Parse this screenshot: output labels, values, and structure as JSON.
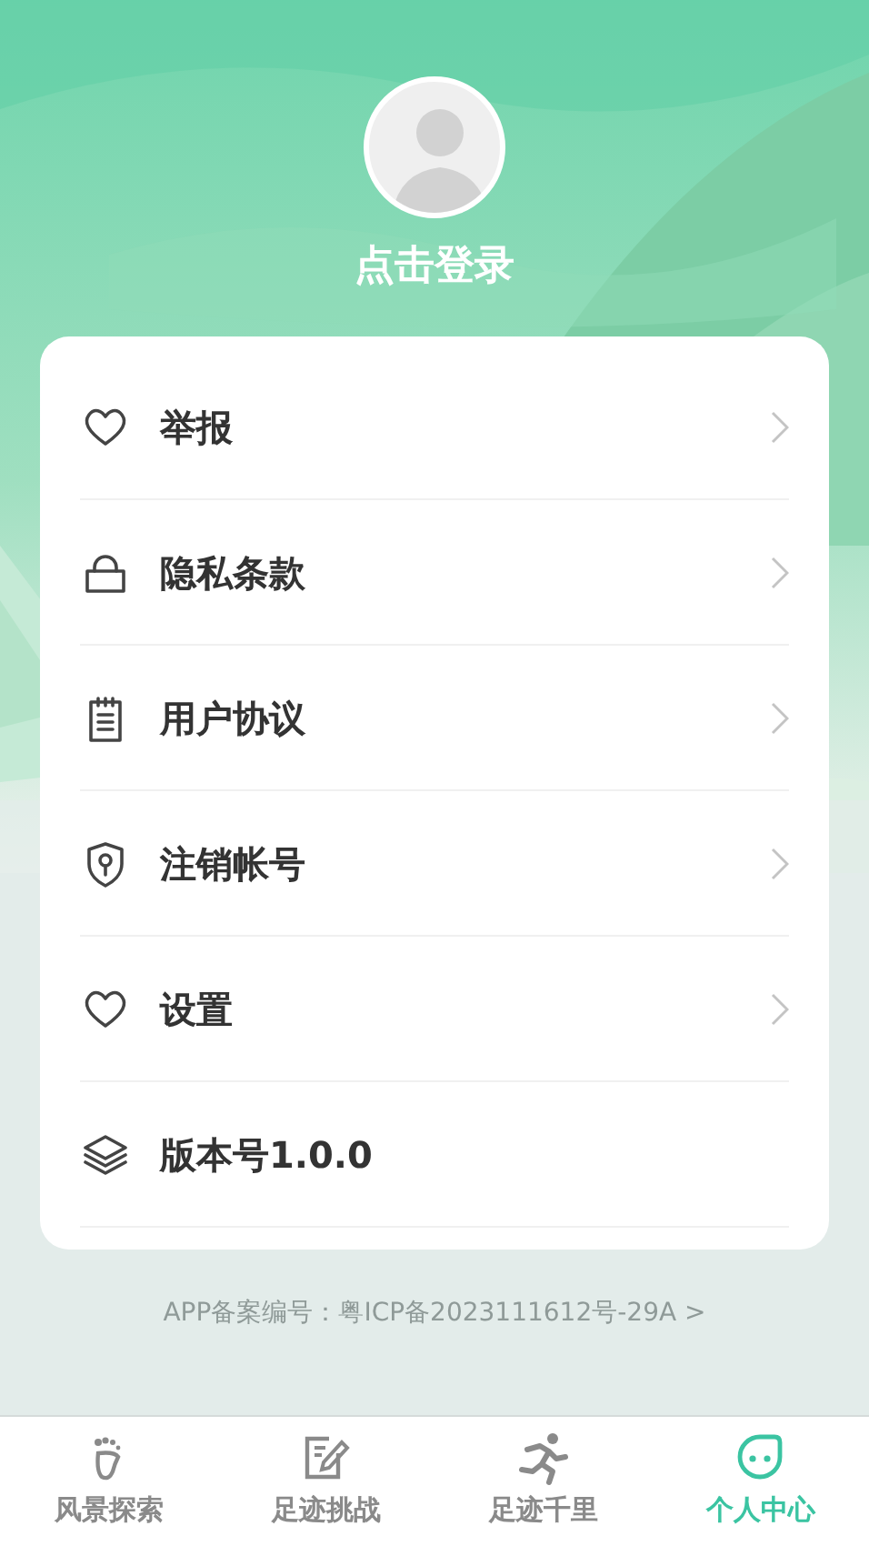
{
  "profile": {
    "login": "点击登录"
  },
  "menu": [
    {
      "label": "举报",
      "kind": "link"
    },
    {
      "label": "隐私条款",
      "kind": "link"
    },
    {
      "label": "用户协议",
      "kind": "link"
    },
    {
      "label": "注销帐号",
      "kind": "link"
    },
    {
      "label": "设置",
      "kind": "link"
    },
    {
      "label": "版本号1.0.0",
      "kind": "info"
    }
  ],
  "footer": "APP备案编号：粤ICP备2023111612号-29A >",
  "tab_bar": [
    {
      "label": "风景探索",
      "selected": false
    },
    {
      "label": "足迹挑战",
      "selected": false
    },
    {
      "label": "足迹千里",
      "selected": false
    },
    {
      "label": "个人中心",
      "selected": true
    }
  ]
}
